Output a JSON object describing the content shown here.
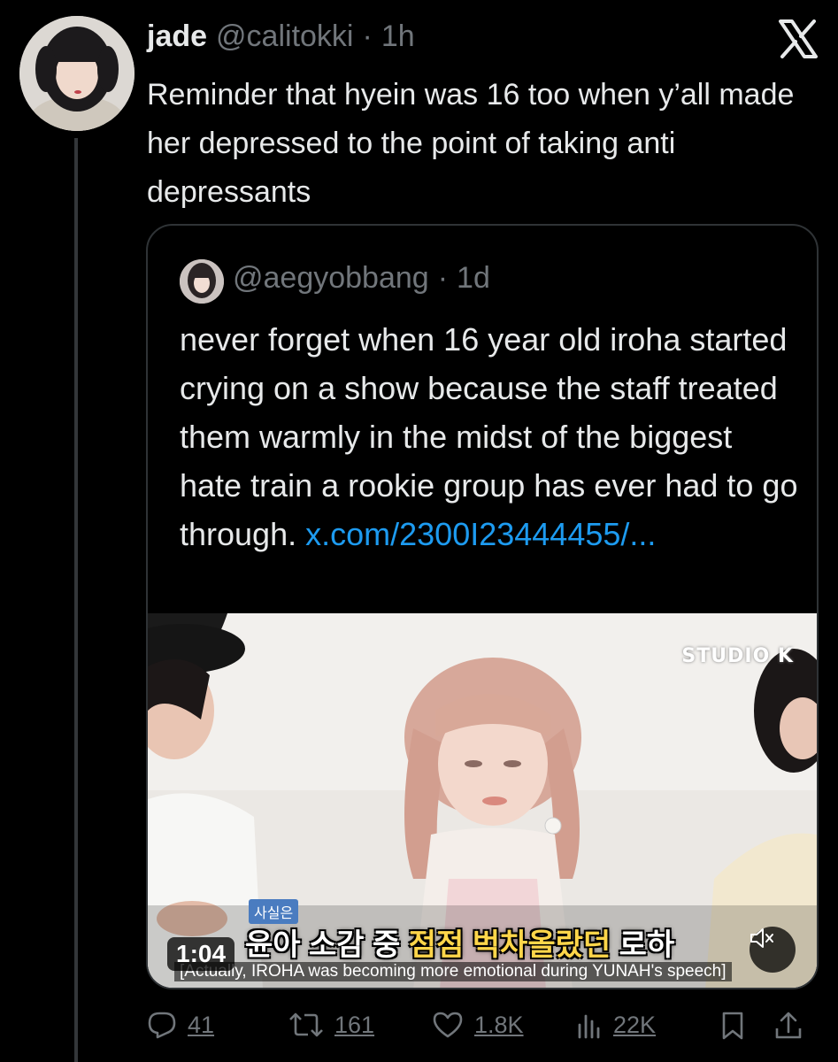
{
  "author": {
    "name": "jade",
    "handle": "@calitokki",
    "separator": "·",
    "time": "1h"
  },
  "tweet": {
    "text": "Reminder that hyein was 16 too when y’all made her depressed to the point of taking anti depressants"
  },
  "quote": {
    "handle": "@aegyobbang",
    "separator": "·",
    "time": "1d",
    "text": "never forget when 16 year old iroha started crying on a show because the staff treated them warmly in the midst of the biggest hate train a rookie group has ever had to go through. ",
    "link": "x.com/2300I23444455/..."
  },
  "video": {
    "duration": "1:04",
    "watermark": "STUDIO K",
    "caption_small": "사실은",
    "subtitle_ko_1": "윤아 소감 중 ",
    "subtitle_ko_2": "점점 벅차올랐던",
    "subtitle_ko_3": " 로하",
    "subtitle_en": "[Actually, IROHA was becoming more emotional during YUNAH's speech]"
  },
  "actions": {
    "replies": "41",
    "reposts": "161",
    "likes": "1.8K",
    "views": "22K"
  },
  "icons": {
    "platform": "x-logo-icon",
    "reply": "reply-icon",
    "repost": "repost-icon",
    "like": "heart-icon",
    "views": "views-icon",
    "bookmark": "bookmark-icon",
    "share": "share-icon",
    "mute": "speaker-muted-icon"
  },
  "colors": {
    "background": "#000000",
    "text": "#e7e9ea",
    "muted": "#71767b",
    "link": "#1d9bf0",
    "border": "#2f3336"
  }
}
